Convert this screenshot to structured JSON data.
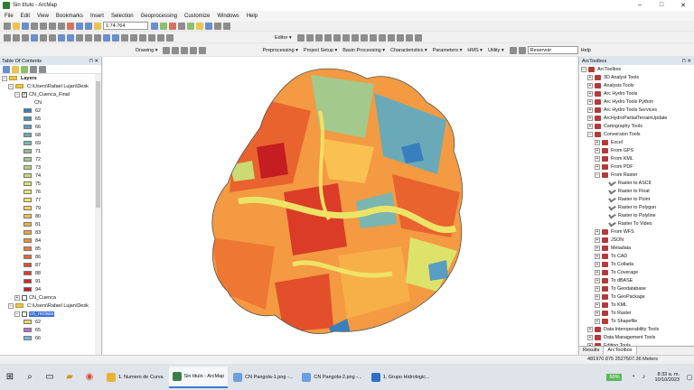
{
  "window": {
    "title": "Sin título - ArcMap",
    "controls": [
      "–",
      "□",
      "✕"
    ]
  },
  "menu": [
    "File",
    "Edit",
    "View",
    "Bookmarks",
    "Insert",
    "Selection",
    "Geoprocessing",
    "Customize",
    "Windows",
    "Help"
  ],
  "toolbar": {
    "scale": "1:74.764",
    "editor_label": "Editor ▾",
    "drawing_label": "Drawing ▾",
    "hydro_menus": [
      "Preprocessing ▾",
      "Project Setup ▾",
      "Basin Processing ▾",
      "Characteristics ▾",
      "Parameters ▾",
      "HMS ▾",
      "Utility ▾"
    ],
    "reservoir": "Reservoir",
    "help_label": "Help"
  },
  "toc": {
    "title": "Table Of Contents",
    "pin": "⊓ ✕",
    "layers_label": "Layers",
    "group1_path": "C:\\Users\\Rafael Lujan\\Desk",
    "layer1_name": "CN_Cuenca_Final",
    "field_name": "CN",
    "cn_classes": [
      {
        "v": "62",
        "c": "#3a7fbd"
      },
      {
        "v": "65",
        "c": "#4a8fc0"
      },
      {
        "v": "66",
        "c": "#5a9dc2"
      },
      {
        "v": "68",
        "c": "#6aaab8"
      },
      {
        "v": "69",
        "c": "#7bb5b0"
      },
      {
        "v": "71",
        "c": "#8dbf9d"
      },
      {
        "v": "72",
        "c": "#a3c98d"
      },
      {
        "v": "73",
        "c": "#b8d27e"
      },
      {
        "v": "74",
        "c": "#cbda72"
      },
      {
        "v": "75",
        "c": "#dde36a"
      },
      {
        "v": "76",
        "c": "#ece467"
      },
      {
        "v": "77",
        "c": "#f6df63"
      },
      {
        "v": "79",
        "c": "#f8d15a"
      },
      {
        "v": "80",
        "c": "#f8c151"
      },
      {
        "v": "81",
        "c": "#f7b048"
      },
      {
        "v": "83",
        "c": "#f59e40"
      },
      {
        "v": "84",
        "c": "#f28b39"
      },
      {
        "v": "85",
        "c": "#ee7733"
      },
      {
        "v": "86",
        "c": "#e9632e"
      },
      {
        "v": "87",
        "c": "#e34f2a"
      },
      {
        "v": "88",
        "c": "#db3c27"
      },
      {
        "v": "91",
        "c": "#d22c25"
      },
      {
        "v": "94",
        "c": "#c41d22"
      }
    ],
    "layer2_name": "CN_Cuenca",
    "group2_path": "C:\\Users\\Rafael Lujan\\Desk",
    "layer3_name": "cn_reclass",
    "layer3_classes": [
      {
        "v": "62",
        "c": "#e8d76b"
      },
      {
        "v": "65",
        "c": "#b573c9"
      },
      {
        "v": "66",
        "c": "#7fb5e0"
      }
    ]
  },
  "toolbox": {
    "title": "ArcToolbox",
    "root": "ArcToolbox",
    "top_items": [
      "3D Analyst Tools",
      "Analysis Tools",
      "Arc Hydro Tools",
      "Arc Hydro Tools Python",
      "Arc Hydro Tools Services",
      "ArcHydroPartialTerrainUpdate",
      "Cartography Tools",
      "Conversion Tools"
    ],
    "conversion_children_a": [
      "Excel",
      "From GPS",
      "From KML",
      "From PDF",
      "From Raster"
    ],
    "from_raster_tools": [
      "Raster to ASCII",
      "Raster to Float",
      "Raster to Point",
      "Raster to Polygon",
      "Raster to Polyline",
      "Raster To Video"
    ],
    "conversion_children_b": [
      "From WFS",
      "JSON",
      "Metadata",
      "To CAD",
      "To Collada",
      "To Coverage",
      "To dBASE",
      "To Geodatabase",
      "To GeoPackage",
      "To KML",
      "To Raster",
      "To Shapefile"
    ],
    "bottom_items": [
      "Data Interoperability Tools",
      "Data Management Tools",
      "Editing Tools"
    ],
    "tabs": [
      "Results",
      "ArcToolbox"
    ]
  },
  "status": {
    "coordinates": "481970.875 2527507.36 Meters"
  },
  "taskbar": {
    "apps": [
      {
        "label": "1. Numero de Curva",
        "color": "#e8b431",
        "active": false
      },
      {
        "label": "Sin titulo - ArcMap",
        "color": "#3d7f4a",
        "active": true
      },
      {
        "label": "CN Pangola-1.png -...",
        "color": "#6aa0e0",
        "active": false
      },
      {
        "label": "CN Pangola-2.png -...",
        "color": "#6aa0e0",
        "active": false
      },
      {
        "label": "1. Grupo Hidrologic...",
        "color": "#2f6fc6",
        "active": false
      }
    ],
    "battery": "50%",
    "time": "8:33 a. m.",
    "date": "10/10/2023"
  }
}
